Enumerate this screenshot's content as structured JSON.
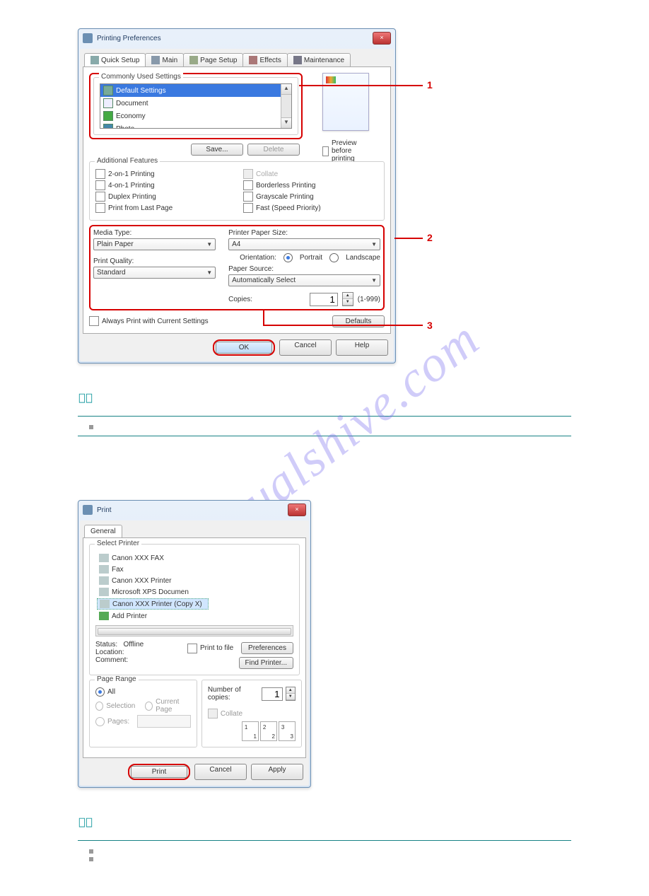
{
  "watermark": "manualshive.com",
  "win1": {
    "title": "Printing Preferences",
    "tabs": [
      "Quick Setup",
      "Main",
      "Page Setup",
      "Effects",
      "Maintenance"
    ],
    "commonly_used": {
      "legend": "Commonly Used Settings",
      "items": [
        "Default Settings",
        "Document",
        "Economy",
        "Photo"
      ],
      "save": "Save...",
      "delete": "Delete"
    },
    "preview_label": "Preview before printing",
    "additional": {
      "legend": "Additional Features",
      "left": [
        "2-on-1 Printing",
        "4-on-1 Printing",
        "Duplex Printing",
        "Print from Last Page"
      ],
      "right": [
        "Collate",
        "Borderless Printing",
        "Grayscale Printing",
        "Fast (Speed Priority)"
      ]
    },
    "media": {
      "media_type_lbl": "Media Type:",
      "media_type_val": "Plain Paper",
      "quality_lbl": "Print Quality:",
      "quality_val": "Standard",
      "paper_size_lbl": "Printer Paper Size:",
      "paper_size_val": "A4",
      "orientation_lbl": "Orientation:",
      "portrait": "Portrait",
      "landscape": "Landscape",
      "source_lbl": "Paper Source:",
      "source_val": "Automatically Select",
      "copies_lbl": "Copies:",
      "copies_val": "1",
      "copies_range": "(1-999)"
    },
    "always_print": "Always Print with Current Settings",
    "defaults": "Defaults",
    "ok": "OK",
    "cancel": "Cancel",
    "help": "Help"
  },
  "callouts": {
    "c1": "1",
    "c2": "2",
    "c3": "3"
  },
  "win2": {
    "title": "Print",
    "tab": "General",
    "select_printer": "Select Printer",
    "printers": [
      "Canon XXX FAX",
      "Canon XXX Printer",
      "Canon XXX Printer (Copy X)",
      "Fax",
      "Microsoft XPS Documen",
      "Add Printer"
    ],
    "status_lbl": "Status:",
    "status_val": "Offline",
    "location_lbl": "Location:",
    "comment_lbl": "Comment:",
    "print_to_file": "Print to file",
    "preferences": "Preferences",
    "find_printer": "Find Printer...",
    "page_range": {
      "legend": "Page Range",
      "all": "All",
      "selection": "Selection",
      "current": "Current Page",
      "pages": "Pages:"
    },
    "num_copies_lbl": "Number of copies:",
    "num_copies_val": "1",
    "collate": "Collate",
    "print": "Print",
    "cancel": "Cancel",
    "apply": "Apply"
  }
}
